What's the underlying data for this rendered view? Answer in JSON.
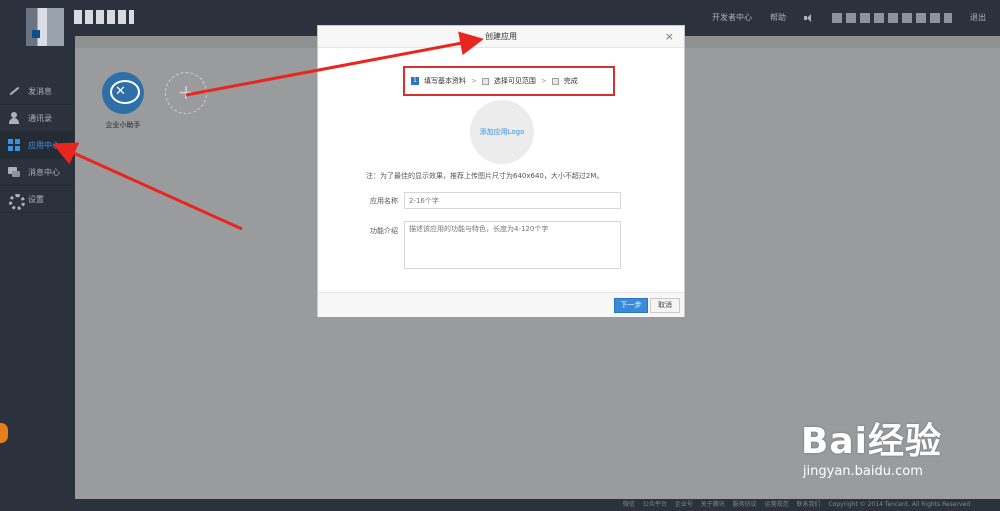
{
  "topbar": {
    "links": [
      "开发者中心",
      "帮助",
      "退出"
    ]
  },
  "sidebar": {
    "items": [
      {
        "label": "发消息",
        "icon": "pen-icon"
      },
      {
        "label": "通讯录",
        "icon": "contacts-icon"
      },
      {
        "label": "应用中心",
        "icon": "grid-icon"
      },
      {
        "label": "消息中心",
        "icon": "messages-icon"
      },
      {
        "label": "设置",
        "icon": "gear-icon"
      }
    ],
    "active_index": 2
  },
  "main": {
    "app_name": "企业小助手",
    "add_symbol": "+"
  },
  "dialog": {
    "title": "创建应用",
    "close": "×",
    "steps": [
      "填写基本资料",
      "选择可见范围",
      "完成"
    ],
    "step_number": "1",
    "step_separator": ">",
    "upload_label": "添加应用Logo",
    "note": "注：为了最佳的显示效果，推荐上传图片尺寸为640x640，大小不超过2M。",
    "name_label": "应用名称",
    "name_placeholder": "2-16个字",
    "desc_label": "功能介绍",
    "desc_placeholder": "描述该应用的功能与特色，长度为4-120个字",
    "next_button": "下一步",
    "cancel_button": "取消"
  },
  "footer": {
    "items": [
      "微信",
      "公众平台",
      "企业号",
      "关于腾讯",
      "服务协议",
      "运营规范",
      "联系我们",
      "Copyright © 2014 Tencent. All Rights Reserved"
    ]
  },
  "watermark": {
    "brand": "Bai经验",
    "url": "jingyan.baidu.com"
  },
  "colors": {
    "annotation": "#e8261f",
    "accent": "#3b8bdb"
  }
}
